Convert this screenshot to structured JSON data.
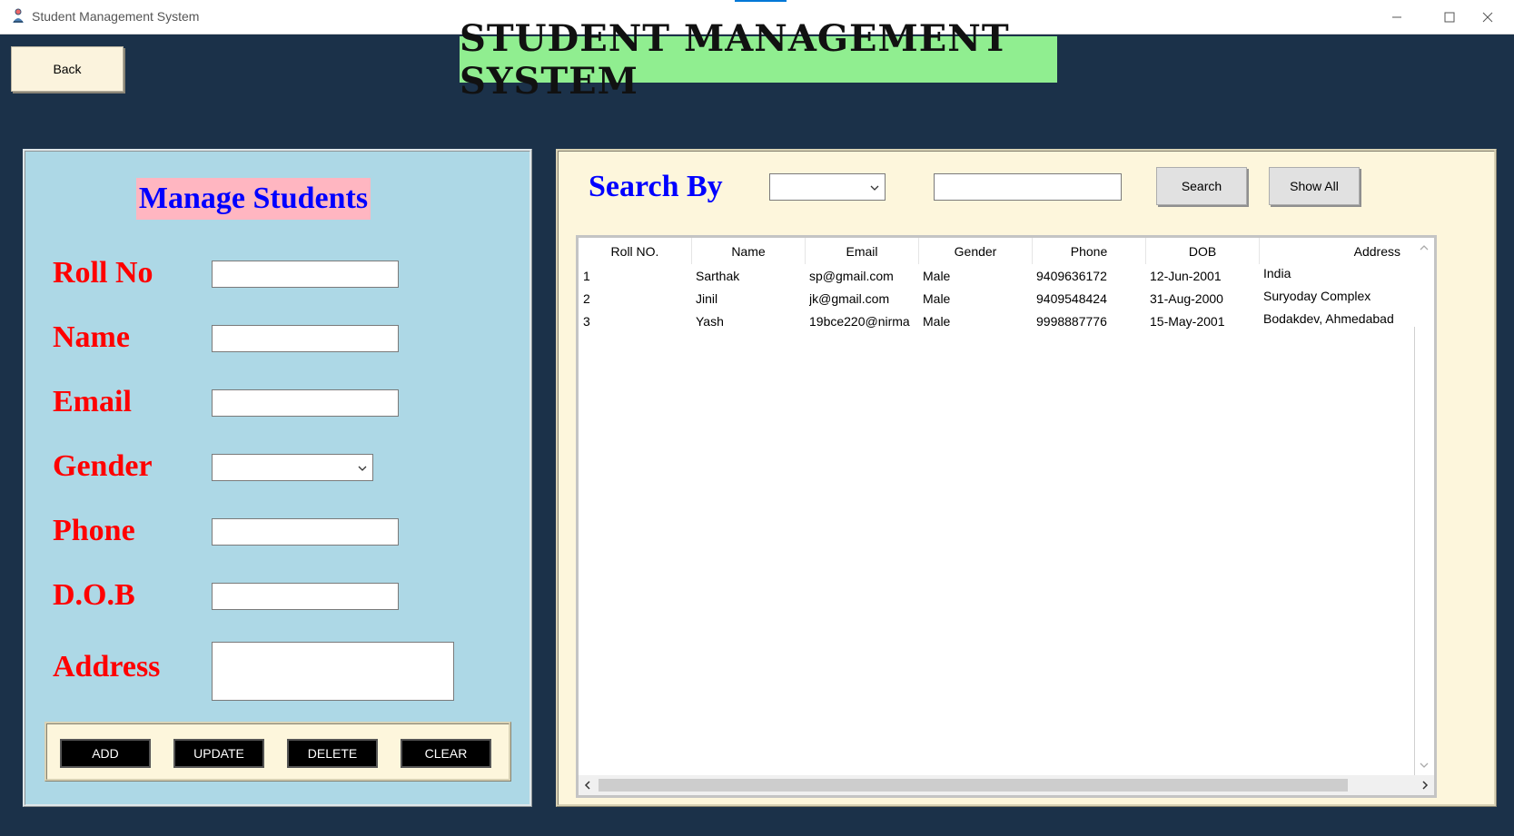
{
  "window": {
    "title": "Student Management System",
    "controls": [
      "minimize",
      "maximize",
      "close"
    ]
  },
  "back_label": "Back",
  "banner_title": "STUDENT MANAGEMENT SYSTEM",
  "manage": {
    "title": "Manage Students",
    "fields": {
      "roll_no": {
        "label": "Roll No",
        "value": ""
      },
      "name": {
        "label": "Name",
        "value": ""
      },
      "email": {
        "label": "Email",
        "value": ""
      },
      "gender": {
        "label": "Gender",
        "value": ""
      },
      "phone": {
        "label": "Phone",
        "value": ""
      },
      "dob": {
        "label": "D.O.B",
        "value": ""
      },
      "address": {
        "label": "Address",
        "value": ""
      }
    },
    "buttons": {
      "add": "ADD",
      "update": "UPDATE",
      "delete": "DELETE",
      "clear": "CLEAR"
    }
  },
  "search": {
    "label": "Search By",
    "by_value": "",
    "text_value": "",
    "search_button": "Search",
    "show_all_button": "Show All"
  },
  "table": {
    "columns": [
      "Roll NO.",
      "Name",
      "Email",
      "Gender",
      "Phone",
      "DOB",
      "Address"
    ],
    "rows": [
      [
        "1",
        "Sarthak",
        "sp@gmail.com",
        "Male",
        "9409636172",
        "12-Jun-2001",
        "India"
      ],
      [
        "2",
        "Jinil",
        "jk@gmail.com",
        "Male",
        "9409548424",
        "31-Aug-2000",
        "Suryoday Complex"
      ],
      [
        "3",
        "Yash",
        "19bce220@nirma",
        "Male",
        "9998887776",
        "15-May-2001",
        "Bodakdev, Ahmedabad"
      ]
    ]
  },
  "colors": {
    "background": "#1b3149",
    "banner": "#90ee90",
    "left_panel": "#add8e6",
    "panel_title_bg": "#ffb6c1",
    "label_red": "#ff0000",
    "label_blue": "#0000ff",
    "right_panel": "#fdf6dc"
  },
  "icons": {
    "app": "app-icon",
    "dropdown": "chevron-down-icon",
    "scroll_left": "chevron-left-icon",
    "scroll_right": "chevron-right-icon",
    "scroll_up": "chevron-up-icon",
    "scroll_down": "chevron-down-icon"
  }
}
